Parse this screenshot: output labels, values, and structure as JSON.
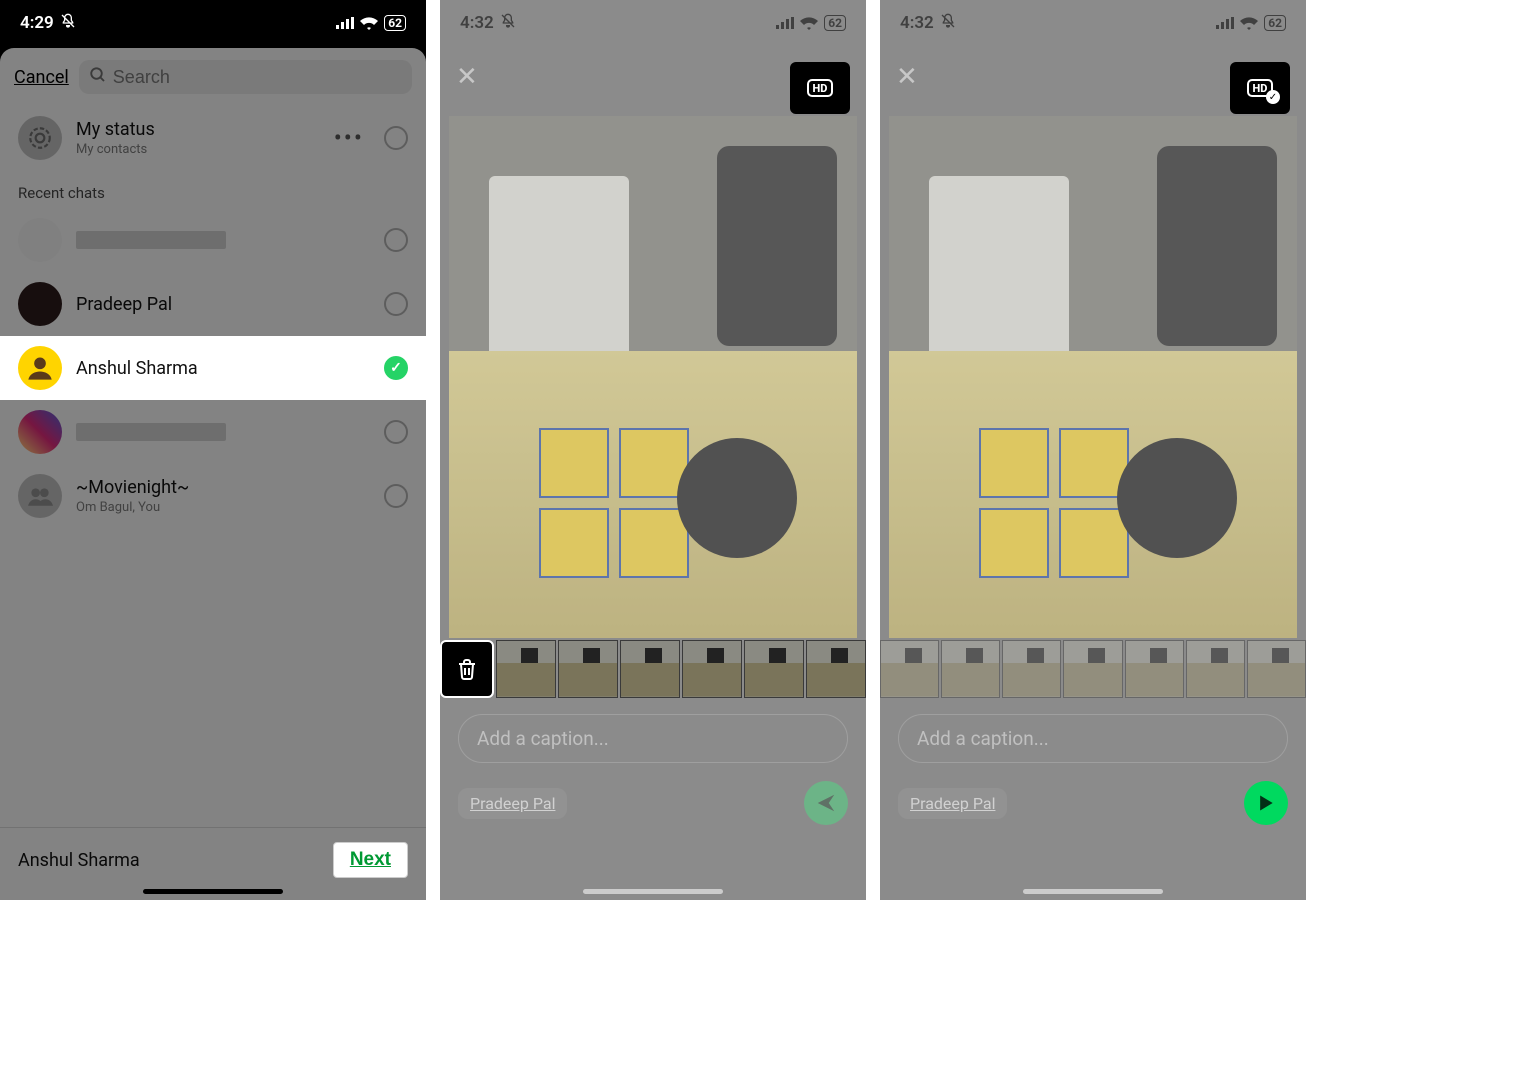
{
  "phone1": {
    "statusbar": {
      "time": "4:29",
      "battery": "62"
    },
    "cancel": "Cancel",
    "search_placeholder": "Search",
    "my_status": {
      "title": "My status",
      "subtitle": "My contacts"
    },
    "section_recent": "Recent chats",
    "chats": [
      {
        "name": "",
        "redacted": true,
        "checked": false
      },
      {
        "name": "Pradeep Pal",
        "checked": false
      },
      {
        "name": "Anshul Sharma",
        "checked": true,
        "highlight": true
      },
      {
        "name": "",
        "redacted": true,
        "checked": false,
        "avatar": "ig"
      },
      {
        "name": "~Movienight~",
        "sub": "Om Bagul, You",
        "checked": false,
        "avatar": "group"
      }
    ],
    "footer": {
      "selected": "Anshul Sharma",
      "next": "Next"
    }
  },
  "phone2": {
    "statusbar": {
      "time": "4:32",
      "battery": "62"
    },
    "hd_label": "HD",
    "hd_checked": false,
    "caption_placeholder": "Add a caption...",
    "recipient": "Pradeep Pal"
  },
  "phone3": {
    "statusbar": {
      "time": "4:32",
      "battery": "62"
    },
    "hd_label": "HD",
    "hd_checked": true,
    "caption_placeholder": "Add a caption...",
    "recipient": "Pradeep Pal"
  }
}
